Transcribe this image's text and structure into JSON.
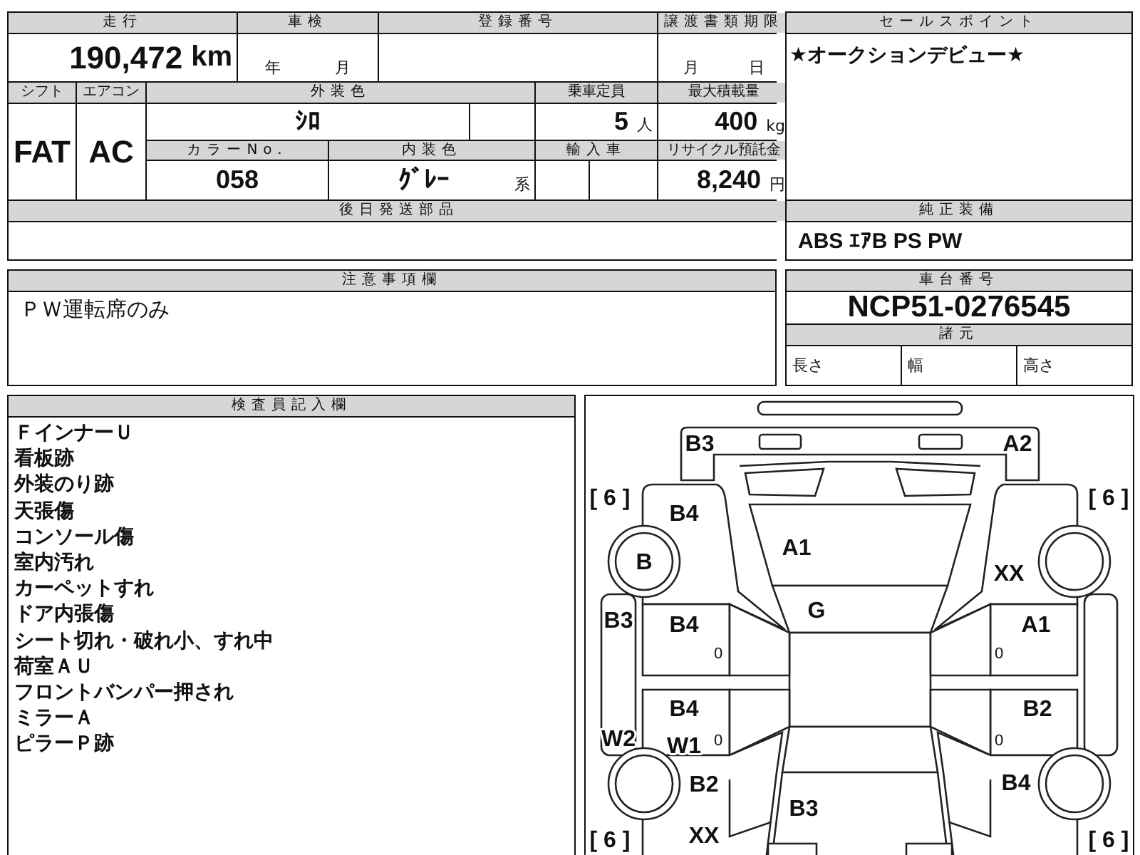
{
  "top_table": {
    "mileage_header": "走行",
    "mileage": "190,472",
    "mileage_unit": "km",
    "inspection_header": "車検",
    "inspection_year_unit": "年",
    "inspection_month_unit": "月",
    "registration_header": "登録番号",
    "transfer_deadline_header": "譲渡書類期限",
    "transfer_month_unit": "月",
    "transfer_day_unit": "日",
    "shift_header": "シフト",
    "aircon_header": "エアコン",
    "exterior_color_header": "外装色",
    "capacity_header": "乗車定員",
    "max_load_header": "最大積載量",
    "shift": "FAT",
    "aircon": "AC",
    "exterior_color": "ｼﾛ",
    "capacity": "5",
    "capacity_unit": "人",
    "max_load": "400",
    "max_load_unit": "kg",
    "color_no_header": "カラーNo.",
    "interior_color_header": "内装色",
    "import_header": "輸入車",
    "recycle_fee_header": "リサイクル預託金",
    "color_no": "058",
    "interior_color": "ｸﾞﾚｰ",
    "interior_color_suffix": "系",
    "recycle_fee": "8,240",
    "recycle_fee_unit": "円",
    "later_parts_header": "後日発送部品"
  },
  "sales_point": {
    "header": "セールスポイント",
    "text": "★オークションデビュー★"
  },
  "equipment": {
    "header": "純正装備",
    "text": "ABS ｴｱB PS PW"
  },
  "notes": {
    "header": "注意事項欄",
    "text": "ＰＷ運転席のみ"
  },
  "chassis": {
    "header": "車台番号",
    "number": "NCP51-0276545",
    "specs_header": "諸元",
    "length_label": "長さ",
    "width_label": "幅",
    "height_label": "高さ"
  },
  "inspector": {
    "header": "検査員記入欄",
    "lines": [
      "ＦインナーＵ",
      "看板跡",
      "外装のり跡",
      "天張傷",
      "コンソール傷",
      "室内汚れ",
      "カーペットすれ",
      "ドア内張傷",
      "シート切れ・破れ小、すれ中",
      "荷室ＡＵ",
      "フロントバンパー押され",
      "ミラーＡ",
      "ピラーＰ跡"
    ]
  },
  "diagram": {
    "tire_marks": [
      "[ 6 ]",
      "[ 6 ]",
      "[ 6 ]",
      "[ 6 ]"
    ],
    "damage_codes": [
      "B3",
      "A2",
      "B4",
      "B",
      "A1",
      "XX",
      "G",
      "B3",
      "B4",
      "A1",
      "B4",
      "B2",
      "W2",
      "W1",
      "B2",
      "B4",
      "B3",
      "XX"
    ],
    "door_marks": [
      "0",
      "0",
      "0",
      "0"
    ]
  }
}
